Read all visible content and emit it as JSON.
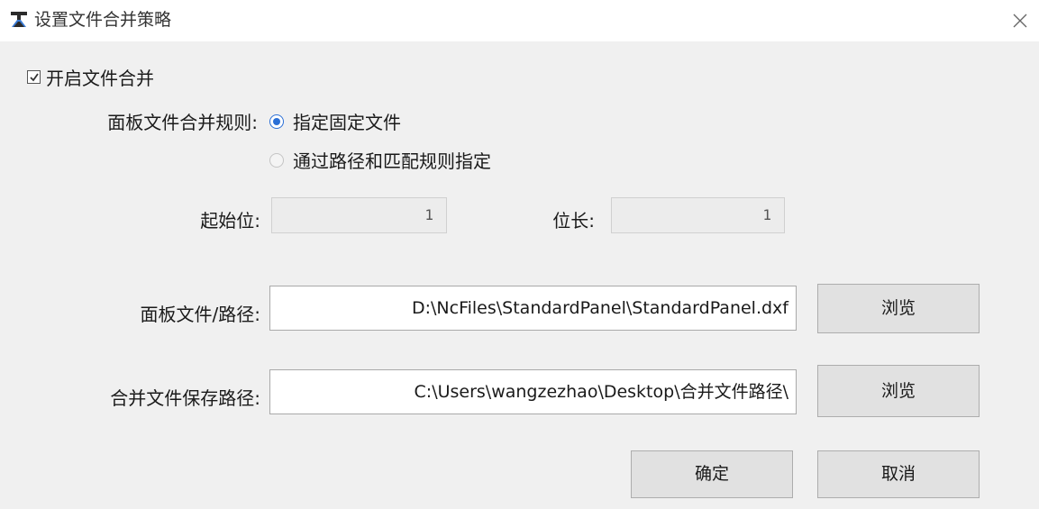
{
  "window": {
    "title": "设置文件合并策略",
    "icon": "app-logo-icon",
    "close_icon": "close-icon"
  },
  "merge_toggle": {
    "label": "开启文件合并",
    "checked": true
  },
  "panel_rule": {
    "label": "面板文件合并规则:",
    "options": [
      {
        "label": "指定固定文件",
        "checked": true
      },
      {
        "label": "通过路径和匹配规则指定",
        "checked": false
      }
    ]
  },
  "start_pos": {
    "label": "起始位:",
    "value": "1"
  },
  "bit_length": {
    "label": "位长:",
    "value": "1"
  },
  "panel_path": {
    "label": "面板文件/路径:",
    "value": "D:\\NcFiles\\StandardPanel\\StandardPanel.dxf",
    "browse_label": "浏览"
  },
  "save_path": {
    "label": "合并文件保存路径:",
    "value": "C:\\Users\\wangzezhao\\Desktop\\合并文件路径\\",
    "browse_label": "浏览"
  },
  "footer": {
    "ok_label": "确定",
    "cancel_label": "取消"
  },
  "colors": {
    "radio_accent": "#2a6fd6",
    "dialog_bg": "#f0f0f0"
  }
}
